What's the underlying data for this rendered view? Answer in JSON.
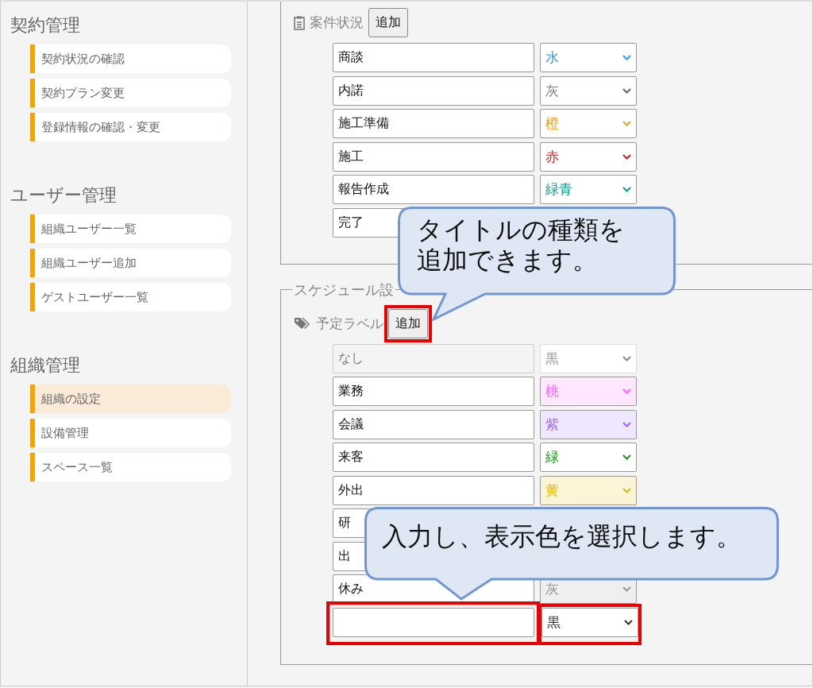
{
  "sidebar": {
    "groups": [
      {
        "title": "契約管理",
        "items": [
          {
            "label": "契約状況の確認",
            "selected": false
          },
          {
            "label": "契約プラン変更",
            "selected": false
          },
          {
            "label": "登録情報の確認・変更",
            "selected": false
          }
        ]
      },
      {
        "title": "ユーザー管理",
        "items": [
          {
            "label": "組織ユーザー一覧",
            "selected": false
          },
          {
            "label": "組織ユーザー追加",
            "selected": false
          },
          {
            "label": "ゲストユーザー一覧",
            "selected": false
          }
        ]
      },
      {
        "title": "組織管理",
        "items": [
          {
            "label": "組織の設定",
            "selected": true
          },
          {
            "label": "設備管理",
            "selected": false
          },
          {
            "label": "スペース一覧",
            "selected": false
          }
        ]
      }
    ]
  },
  "sections": [
    {
      "kind": "status",
      "heading": "案件状況",
      "add_button": "追加",
      "rows": [
        {
          "name": "商談",
          "color_label": "水",
          "color": "#3399ff"
        },
        {
          "name": "内諾",
          "color_label": "灰",
          "color": "#888888"
        },
        {
          "name": "施工準備",
          "color_label": "橙",
          "color": "#ff9900"
        },
        {
          "name": "施工",
          "color_label": "赤",
          "color": "#ee1111"
        },
        {
          "name": "報告作成",
          "color_label": "緑青",
          "color": "#119988"
        },
        {
          "name": "完了"
        }
      ]
    },
    {
      "kind": "label",
      "legend": "スケジュール設",
      "heading": "予定ラベル",
      "add_button": "追加",
      "add_highlighted": true,
      "rows": [
        {
          "name": "なし",
          "color_label": "黒",
          "color": "#999999",
          "disabled": true
        },
        {
          "name": "業務",
          "color_label": "桃",
          "color": "#ff66ff",
          "disabled": false
        },
        {
          "name": "会議",
          "color_label": "紫",
          "color": "#9966ff",
          "disabled": false
        },
        {
          "name": "来客",
          "color_label": "緑",
          "color": "#119911",
          "disabled": false
        },
        {
          "name": "外出",
          "color_label": "黄",
          "color": "#e6b800",
          "disabled": false
        },
        {
          "name": "研",
          "disabled": false
        },
        {
          "name": "出",
          "disabled": false
        },
        {
          "name": "休み",
          "color_label": "灰",
          "color": "#999999",
          "disabled": false
        },
        {
          "color_label": "黒",
          "color": "#333333",
          "disabled": false,
          "highlighted": true
        }
      ]
    }
  ],
  "callouts": [
    {
      "text": "タイトルの種類を追加できます。"
    },
    {
      "text": "入力し、表示色を選択します。"
    }
  ]
}
